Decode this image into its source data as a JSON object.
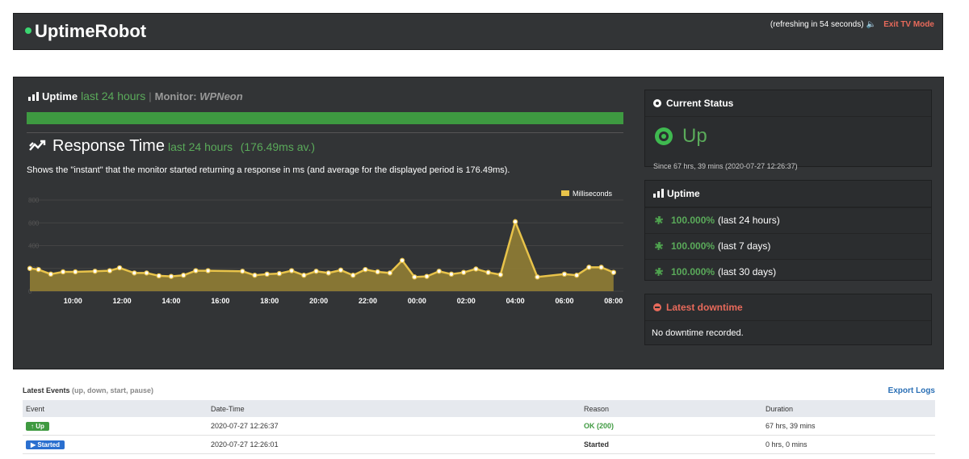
{
  "header": {
    "logo": "UptimeRobot",
    "refresh_text": "(refreshing in 54 seconds)",
    "exit_label": "Exit TV Mode"
  },
  "uptime_bar": {
    "title": "Uptime",
    "range": "last 24 hours",
    "separator": "|",
    "monitor_label": "Monitor:",
    "monitor_name": "WPNeon",
    "uptime_fraction": 1.0,
    "color": "#3e9a41"
  },
  "response_time": {
    "title": "Response Time",
    "range": "last 24 hours",
    "average": "(176.49ms av.)",
    "description": "Shows the \"instant\" that the monitor started returning a response in ms (and average for the displayed period is 176.49ms)."
  },
  "chart_data": {
    "type": "area",
    "legend": "Milliseconds",
    "legend_position": "top-right",
    "ylim": [
      0,
      800
    ],
    "yticks": [
      0,
      200,
      400,
      600,
      800
    ],
    "grid": true,
    "x_tick_labels": [
      "10:00",
      "12:00",
      "14:00",
      "16:00",
      "18:00",
      "20:00",
      "22:00",
      "00:00",
      "02:00",
      "04:00",
      "06:00",
      "08:00"
    ],
    "x_tick_hours": [
      10,
      12,
      14,
      16,
      18,
      20,
      22,
      24,
      26,
      28,
      30,
      32
    ],
    "xlim": [
      8.25,
      32.4
    ],
    "series": [
      {
        "color": "#e8c34a",
        "fill": "#8c7a35",
        "points": [
          [
            8.25,
            200
          ],
          [
            8.6,
            190
          ],
          [
            9.1,
            150
          ],
          [
            9.6,
            170
          ],
          [
            10.1,
            170
          ],
          [
            10.9,
            175
          ],
          [
            11.5,
            180
          ],
          [
            11.9,
            205
          ],
          [
            12.5,
            160
          ],
          [
            13.0,
            160
          ],
          [
            13.5,
            135
          ],
          [
            14.0,
            130
          ],
          [
            14.5,
            140
          ],
          [
            15.0,
            180
          ],
          [
            15.5,
            180
          ],
          [
            16.9,
            175
          ],
          [
            17.4,
            140
          ],
          [
            17.9,
            150
          ],
          [
            18.4,
            155
          ],
          [
            18.9,
            180
          ],
          [
            19.4,
            140
          ],
          [
            19.9,
            175
          ],
          [
            20.4,
            160
          ],
          [
            20.9,
            185
          ],
          [
            21.4,
            140
          ],
          [
            21.9,
            190
          ],
          [
            22.4,
            170
          ],
          [
            22.9,
            160
          ],
          [
            23.4,
            270
          ],
          [
            23.9,
            125
          ],
          [
            24.4,
            130
          ],
          [
            24.9,
            175
          ],
          [
            25.4,
            150
          ],
          [
            25.9,
            165
          ],
          [
            26.4,
            195
          ],
          [
            26.9,
            165
          ],
          [
            27.4,
            145
          ],
          [
            28.0,
            610
          ],
          [
            28.9,
            125
          ],
          [
            30.0,
            150
          ],
          [
            30.5,
            140
          ],
          [
            31.0,
            210
          ],
          [
            31.5,
            210
          ],
          [
            32.0,
            165
          ]
        ]
      }
    ]
  },
  "current_status": {
    "title": "Current Status",
    "status": "Up",
    "since": "Since 67 hrs, 39 mins (2020-07-27 12:26:37)"
  },
  "uptime_card": {
    "title": "Uptime",
    "rows": [
      {
        "pct": "100.000%",
        "range": "(last 24 hours)"
      },
      {
        "pct": "100.000%",
        "range": "(last 7 days)"
      },
      {
        "pct": "100.000%",
        "range": "(last 30 days)"
      }
    ]
  },
  "downtime": {
    "title": "Latest downtime",
    "text": "No downtime recorded."
  },
  "events": {
    "title": "Latest Events",
    "subtitle": "(up, down, start, pause)",
    "export_label": "Export Logs",
    "columns": [
      "Event",
      "Date-Time",
      "Reason",
      "Duration"
    ],
    "rows": [
      {
        "event": "Up",
        "datetime": "2020-07-27 12:26:37",
        "reason": "OK (200)",
        "duration": "67 hrs, 39 mins"
      },
      {
        "event": "Started",
        "datetime": "2020-07-27 12:26:01",
        "reason": "Started",
        "duration": "0 hrs, 0 mins"
      }
    ]
  },
  "colors": {
    "accent_green": "#5aaa5a",
    "danger_red": "#e86a5b",
    "link_blue": "#2a6fb5",
    "panel_bg": "#323436"
  }
}
